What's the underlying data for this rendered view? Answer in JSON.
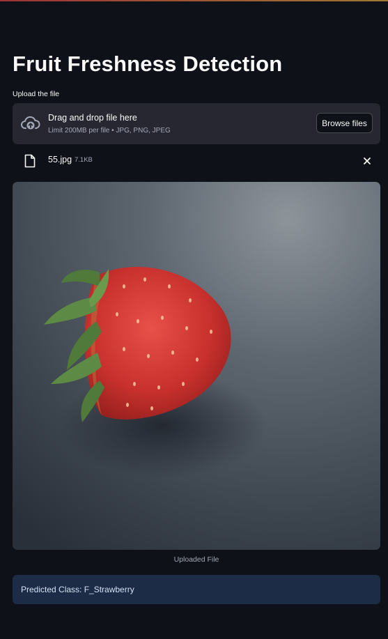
{
  "page": {
    "title": "Fruit Freshness Detection"
  },
  "uploader": {
    "label": "Upload the file",
    "dropzone_title": "Drag and drop file here",
    "dropzone_limits": "Limit 200MB per file • JPG, PNG, JPEG",
    "browse_label": "Browse files",
    "icon": "cloud-upload-icon"
  },
  "uploaded_file": {
    "name": "55.jpg",
    "size": "7.1KB",
    "icon": "file-icon",
    "remove_icon": "close-icon"
  },
  "image": {
    "caption": "Uploaded File",
    "subject": "strawberry"
  },
  "result": {
    "text": "Predicted Class: F_Strawberry"
  },
  "colors": {
    "background": "#0e1117",
    "panel": "#262730",
    "info_bg": "#1c2c46",
    "info_text": "#d5e1f5"
  }
}
